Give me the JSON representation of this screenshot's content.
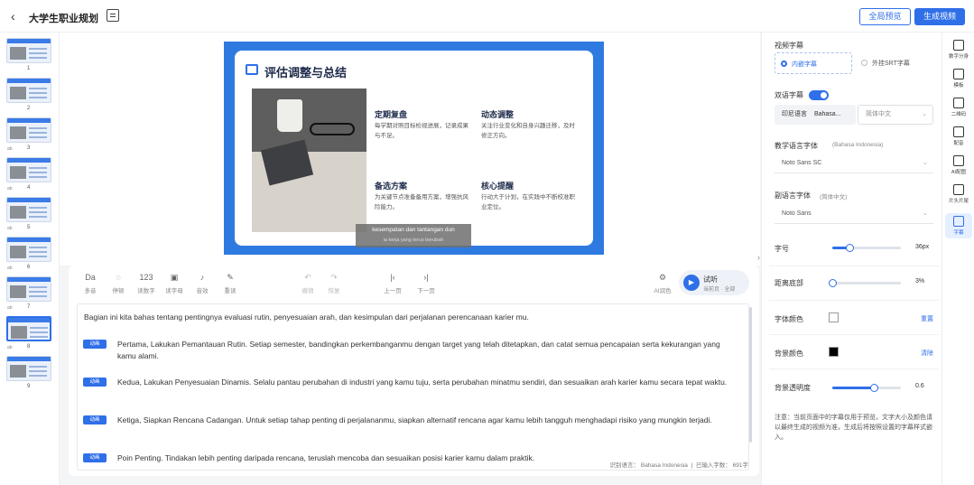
{
  "header": {
    "back_glyph": "‹",
    "title": "大学生职业规划",
    "preview_label": "全局预览",
    "generate_label": "生成视频"
  },
  "thumbnails": [
    {
      "num": "1",
      "tag": ""
    },
    {
      "num": "2",
      "tag": ""
    },
    {
      "num": "3",
      "tag": "ab"
    },
    {
      "num": "4",
      "tag": "ab"
    },
    {
      "num": "5",
      "tag": "ab"
    },
    {
      "num": "6",
      "tag": "ab"
    },
    {
      "num": "7",
      "tag": "ab"
    },
    {
      "num": "8",
      "tag": "ab"
    },
    {
      "num": "9",
      "tag": ""
    }
  ],
  "slide": {
    "title": "评估调整与总结",
    "sections": [
      {
        "heading": "定期复盘",
        "text": "每学期对照目标检视进展，记录成果与不足。"
      },
      {
        "heading": "动态调整",
        "text": "关注行业变化和自身兴趣迁移，及时修正方向。"
      },
      {
        "heading": "备选方案",
        "text": "为关键节点准备备用方案，增强抗风险能力。"
      },
      {
        "heading": "核心提醒",
        "text": "行动大于计划，在实践中不断校准职业定位。"
      }
    ],
    "caption_line1": "kesempatan dan tantangan dun",
    "caption_line2": "ia kerja yang terus berubah"
  },
  "toolbar": {
    "tools": [
      {
        "glyph": "Da",
        "label": "多音",
        "dim": false
      },
      {
        "glyph": "◌",
        "label": "停顿",
        "dim": false
      },
      {
        "glyph": "123",
        "label": "读数字",
        "dim": false
      },
      {
        "glyph": "▣",
        "label": "读字母",
        "dim": false
      },
      {
        "glyph": "♪",
        "label": "音效",
        "dim": false
      },
      {
        "glyph": "✎",
        "label": "重读",
        "dim": false
      },
      {
        "glyph": "↶",
        "label": "撤销",
        "dim": true
      },
      {
        "glyph": "↷",
        "label": "恢复",
        "dim": true
      },
      {
        "glyph": "|‹",
        "label": "上一页",
        "dim": false
      },
      {
        "glyph": "›|",
        "label": "下一页",
        "dim": false
      }
    ],
    "ai_label": "AI润色",
    "ai_glyph": "⚙",
    "voice_name": "试听",
    "voice_sub": "当前页 · 全部",
    "play_glyph": "▶"
  },
  "script": {
    "intro": "Bagian ini kita bahas tentang pentingnya evaluasi rutin, penyesuaian arah, dan kesimpulan dari perjalanan perencanaan karier mu.",
    "paragraphs": [
      {
        "tag": "动画",
        "text": "Pertama, Lakukan Pemantauan Rutin. Setiap semester, bandingkan perkembanganmu dengan target yang telah ditetapkan, dan catat semua pencapaian serta kekurangan yang kamu alami."
      },
      {
        "tag": "动画",
        "text": "Kedua, Lakukan Penyesuaian Dinamis. Selalu pantau perubahan di industri yang kamu tuju, serta perubahan minatmu sendiri, dan sesuaikan arah karier kamu secara tepat waktu."
      },
      {
        "tag": "动画",
        "text": "Ketiga, Siapkan Rencana Cadangan. Untuk setiap tahap penting di perjalananmu, siapkan alternatif rencana agar kamu lebih tangguh menghadapi risiko yang mungkin terjadi."
      },
      {
        "tag": "动画",
        "text": "Poin Penting. Tindakan lebih penting daripada rencana, teruslah mencoba dan sesuaikan posisi karier kamu dalam praktik."
      }
    ],
    "status_lang_label": "识别语言：",
    "status_lang": "Bahasa Indonesia",
    "status_count_label": "已输入字数：",
    "status_count": "691字"
  },
  "panel": {
    "subtitle_label": "视频字幕",
    "opt_embedded": "内嵌字幕",
    "opt_srt": "外挂SRT字幕",
    "bilingual_label": "双语字幕",
    "lang_left": "印尼语言",
    "lang_left_sub": "Bahasa...",
    "lang_right": "简体中文",
    "main_font_label": "教学语言字体",
    "main_font_sub": "(Bahasa Indonesia)",
    "main_font_value": "Noto Sans SC",
    "second_font_label": "副语言字体",
    "second_font_sub": "(简体中文)",
    "second_font_value": "Noto Sans",
    "size_label": "字号",
    "size_value": "36px",
    "size_fraction": 0.25,
    "bottom_label": "距离底部",
    "bottom_value": "3%",
    "bottom_fraction": 0.0,
    "font_color_label": "字体颜色",
    "font_color": "#ffffff",
    "reset_label": "重置",
    "bg_color_label": "背景颜色",
    "bg_color": "#000000",
    "bg_reset_label": "清除",
    "opacity_label": "背景透明度",
    "opacity_value": "0.6",
    "opacity_fraction": 0.6,
    "note": "注意：当前页面中的字幕仅用于预览，文字大小及颜色请以最终生成的视频为准，生成后将按照设置的字幕样式嵌入。"
  },
  "rail": [
    {
      "label": "数字分身"
    },
    {
      "label": "模板"
    },
    {
      "label": "二维码"
    },
    {
      "label": "配音"
    },
    {
      "label": "AI配图"
    },
    {
      "label": "片头片尾"
    },
    {
      "label": "字幕"
    }
  ],
  "colors": {
    "accent": "#2f6fe8",
    "slide_bg": "#2f7ae0"
  }
}
